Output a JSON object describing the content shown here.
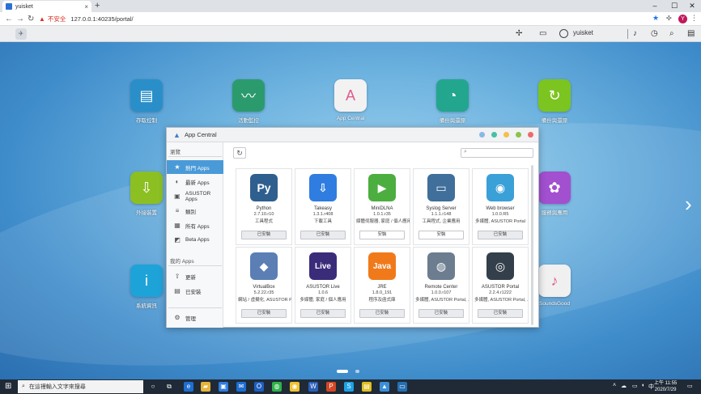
{
  "browser": {
    "tab_title": "yuisket",
    "tab_close": "×",
    "new_tab": "+",
    "security_warning": "不安全",
    "url": "127.0.0.1:40235/portal/",
    "window_controls": [
      "–",
      "☐",
      "✕"
    ],
    "nav": {
      "back": "←",
      "forward": "→",
      "reload": "↻"
    },
    "profile_initial": "Y",
    "icons": {
      "bookmark": "bookmark-star-icon",
      "extensions": "extensions-icon",
      "menu": "kebab-menu-icon"
    }
  },
  "adm_bar": {
    "username": "yuisket",
    "icons": [
      "fan-icon",
      "keyboard-icon",
      "user-icon",
      "notification-icon",
      "clock-icon",
      "search-icon",
      "widget-icon"
    ]
  },
  "desktop": {
    "icons": [
      {
        "label": "存取控制",
        "color": "#2a8fc9",
        "glyph": "▤"
      },
      {
        "label": "活動監控",
        "color": "#2b9b6e",
        "glyph": "〰"
      },
      {
        "label": "App Central",
        "color": "#f2f2f2",
        "glyph": "A"
      },
      {
        "label": "備份與還原",
        "color": "#22a68e",
        "glyph": "◔"
      },
      {
        "label": "備份與還原",
        "color": "#7cc41f",
        "glyph": "↻"
      },
      {
        "label": "外接裝置",
        "color": "#8cbf22",
        "glyph": "⇩"
      },
      {
        "label": "服務與應用",
        "color": "#a24fd0",
        "glyph": "✿"
      },
      {
        "label": "系統資訊",
        "color": "#1ea3d8",
        "glyph": "i"
      },
      {
        "label": "SoundsGood",
        "color": "#f0f0f0",
        "glyph": "♪"
      }
    ],
    "arrow": "›"
  },
  "app_central": {
    "title": "App Central",
    "window_dots": [
      "#8ab8e6",
      "#49c0a5",
      "#f2c14e",
      "#8bc34a",
      "#ef6a6a"
    ],
    "sidebar": {
      "browse_heading": "瀏覽",
      "browse_items": [
        {
          "label": "熱門 Apps",
          "icon": "star-icon",
          "glyph": "★",
          "active": true
        },
        {
          "label": "最新 Apps",
          "icon": "new-apps-icon",
          "glyph": "◐",
          "active": false
        },
        {
          "label": "ASUSTOR Apps",
          "icon": "asustor-icon",
          "glyph": "▣",
          "active": false
        },
        {
          "label": "類別",
          "icon": "list-icon",
          "glyph": "≡",
          "active": false
        },
        {
          "label": "所有 Apps",
          "icon": "grid-icon",
          "glyph": "▦",
          "active": false
        },
        {
          "label": "Beta Apps",
          "icon": "beta-icon",
          "glyph": "◩",
          "active": false
        }
      ],
      "my_apps_heading": "我的 Apps",
      "my_items": [
        {
          "label": "更新",
          "icon": "update-icon",
          "glyph": "⇧"
        },
        {
          "label": "已安裝",
          "icon": "installed-icon",
          "glyph": "▤"
        }
      ],
      "manage": {
        "label": "管理",
        "icon": "manage-icon",
        "glyph": "⚙"
      }
    },
    "refresh_glyph": "↻",
    "search_placeholder": "",
    "apps": [
      {
        "name": "Python",
        "version": "2.7.10.r10",
        "category": "工具程式",
        "button": "已安裝",
        "installed": true,
        "color": "#2f5f8f",
        "glyph": "Py"
      },
      {
        "name": "Takeasy",
        "version": "1.3.1.r408",
        "category": "下載工具",
        "button": "已安裝",
        "installed": true,
        "color": "#2f7de0",
        "glyph": "⇩"
      },
      {
        "name": "MiniDLNA",
        "version": "1.0.1.r35",
        "category": "媒體伺服器, 家庭 / 個人應用",
        "button": "安裝",
        "installed": false,
        "color": "#4cae3f",
        "glyph": "▶"
      },
      {
        "name": "Syslog Server",
        "version": "1.1.1.r148",
        "category": "工具程式, 企業應用",
        "button": "安裝",
        "installed": false,
        "color": "#3f6f9a",
        "glyph": "▭"
      },
      {
        "name": "Web browser",
        "version": "1.0.0.R5",
        "category": "多媒體, ASUSTOR Portal",
        "button": "已安裝",
        "installed": true,
        "color": "#3aa0d8",
        "glyph": "◉"
      },
      {
        "name": "VirtualBox",
        "version": "5.2.22.r35",
        "category": "網站 / 虛擬化, ASUSTOR Portal",
        "button": "已安裝",
        "installed": true,
        "color": "#5b7fb5",
        "glyph": "◆"
      },
      {
        "name": "ASUSTOR Live",
        "version": "1.0.6",
        "category": "多媒體, 家庭 / 個人應用",
        "button": "已安裝",
        "installed": true,
        "color": "#3b2c7a",
        "glyph": "Live"
      },
      {
        "name": "JRE",
        "version": "1.8.0_191",
        "category": "程序及函式庫",
        "button": "已安裝",
        "installed": true,
        "color": "#f07a1a",
        "glyph": "Java"
      },
      {
        "name": "Remote Center",
        "version": "1.0.0.r107",
        "category": "多媒體, ASUSTOR Portal, ...",
        "button": "已安裝",
        "installed": true,
        "color": "#6b7d8e",
        "glyph": "◍"
      },
      {
        "name": "ASUSTOR Portal",
        "version": "2.2.4.r1222",
        "category": "多媒體, ASUSTOR Portal, ...",
        "button": "已安裝",
        "installed": true,
        "color": "#333f4a",
        "glyph": "◎"
      }
    ]
  },
  "taskbar": {
    "search_placeholder": "在這裡輸入文字來搜尋",
    "ime": "中",
    "time": "上午 11:55",
    "date": "2020/7/29"
  }
}
